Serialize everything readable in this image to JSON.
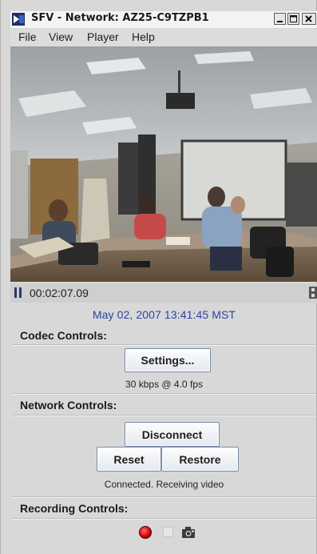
{
  "window": {
    "title": "SFV - Network: AZ25-C9TZPB1",
    "controls": [
      "minimize",
      "maximize",
      "close"
    ]
  },
  "menu": [
    "File",
    "View",
    "Player",
    "Help"
  ],
  "player": {
    "time": "00:02:07.09",
    "state_icon": "pause-icon",
    "film_icon": "film-icon"
  },
  "datetime": "May 02, 2007  13:41:45 MST",
  "codec": {
    "title": "Codec Controls:",
    "settings_label": "Settings...",
    "bitrate": "30 kbps @ 4.0 fps"
  },
  "network": {
    "title": "Network Controls:",
    "disconnect_label": "Disconnect",
    "reset_label": "Reset",
    "restore_label": "Restore",
    "status": "Connected. Receiving video"
  },
  "recording": {
    "title": "Recording Controls:",
    "icons": [
      "record-icon",
      "stop-icon",
      "snapshot-camera-icon"
    ]
  },
  "colors": {
    "datetime": "#2a44a6",
    "record": "#d00000",
    "button_border": "#7a8aa8"
  }
}
